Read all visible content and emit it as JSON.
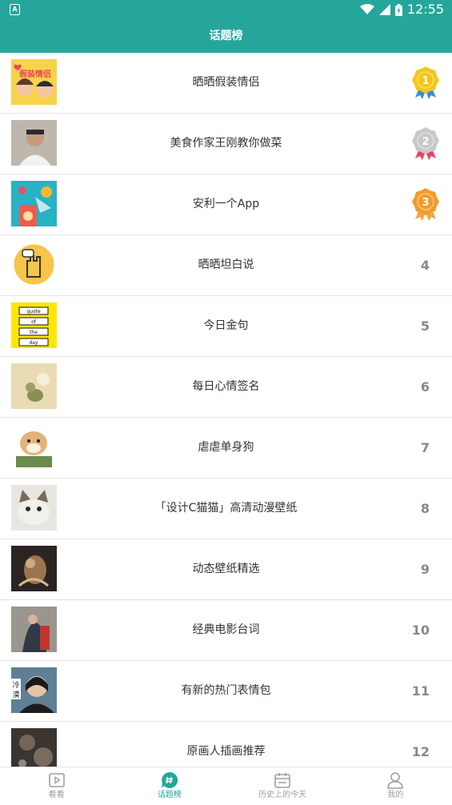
{
  "status": {
    "indicator": "A",
    "time": "12:55"
  },
  "header": {
    "title": "话题榜"
  },
  "topics": [
    {
      "title": "晒晒假装情侣",
      "rank": "1",
      "medal": "gold",
      "thumb_color": "#f6d34a",
      "thumb_text": "假装情侣"
    },
    {
      "title": "美食作家王刚教你做菜",
      "rank": "2",
      "medal": "silver",
      "thumb_color": "#cfc9bf"
    },
    {
      "title": "安利一个App",
      "rank": "3",
      "medal": "bronze",
      "thumb_color": "#27b3c4"
    },
    {
      "title": "晒晒坦白说",
      "rank": "4",
      "thumb_color": "#f7c54b"
    },
    {
      "title": "今日金句",
      "rank": "5",
      "thumb_color": "#ffe600",
      "thumb_words": [
        "quote",
        "of",
        "the",
        "day"
      ]
    },
    {
      "title": "每日心情签名",
      "rank": "6",
      "thumb_color": "#c7b37a"
    },
    {
      "title": "虐虐单身狗",
      "rank": "7",
      "thumb_color": "#ffffff"
    },
    {
      "title": "「设计C猫猫」高清动漫壁纸",
      "rank": "8",
      "thumb_color": "#e8e6e2"
    },
    {
      "title": "动态壁纸精选",
      "rank": "9",
      "thumb_color": "#2a2422"
    },
    {
      "title": "经典电影台词",
      "rank": "10",
      "thumb_color": "#6f6b66"
    },
    {
      "title": "有新的热门表情包",
      "rank": "11",
      "thumb_color": "#2c3c4a",
      "thumb_text": "冷漠"
    },
    {
      "title": "原画人插画推荐",
      "rank": "12",
      "thumb_color": "#3a3531"
    }
  ],
  "tabs": [
    {
      "label": "看看",
      "icon": "play-icon",
      "active": false
    },
    {
      "label": "话题榜",
      "icon": "hashtag-chat-icon",
      "active": true
    },
    {
      "label": "历史上的今天",
      "icon": "calendar-icon",
      "active": false
    },
    {
      "label": "我的",
      "icon": "person-icon",
      "active": false
    }
  ],
  "colors": {
    "accent": "#26a69a",
    "gold": "#f5c518",
    "silver": "#c8c8c8",
    "bronze": "#f39a2b"
  }
}
